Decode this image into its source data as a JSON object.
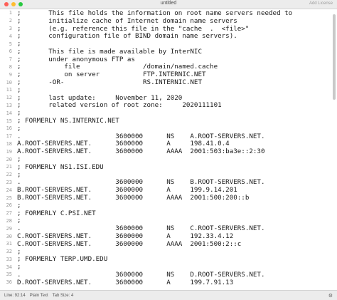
{
  "window": {
    "title": "untitled",
    "add_license": "Add License"
  },
  "editor": {
    "lines": [
      {
        "n": "1",
        "text": ";       This file holds the information on root name servers needed to"
      },
      {
        "n": "2",
        "text": ";       initialize cache of Internet domain name servers"
      },
      {
        "n": "3",
        "text": ";       (e.g. reference this file in the \"cache  .  <file>\""
      },
      {
        "n": "4",
        "text": ";       configuration file of BIND domain name servers)."
      },
      {
        "n": "5",
        "text": ";"
      },
      {
        "n": "6",
        "text": ";       This file is made available by InterNIC"
      },
      {
        "n": "7",
        "text": ";       under anonymous FTP as"
      },
      {
        "n": "8",
        "text": ";           file                /domain/named.cache"
      },
      {
        "n": "9",
        "text": ";           on server           FTP.INTERNIC.NET"
      },
      {
        "n": "10",
        "text": ";       -OR-                    RS.INTERNIC.NET"
      },
      {
        "n": "11",
        "text": ";"
      },
      {
        "n": "12",
        "text": ";       last update:     November 11, 2020"
      },
      {
        "n": "13",
        "text": ";       related version of root zone:     2020111101"
      },
      {
        "n": "14",
        "text": ";"
      },
      {
        "n": "15",
        "text": "; FORMERLY NS.INTERNIC.NET"
      },
      {
        "n": "16",
        "text": ";"
      },
      {
        "n": "17",
        "text": ".                        3600000      NS    A.ROOT-SERVERS.NET."
      },
      {
        "n": "18",
        "text": "A.ROOT-SERVERS.NET.      3600000      A     198.41.0.4"
      },
      {
        "n": "19",
        "text": "A.ROOT-SERVERS.NET.      3600000      AAAA  2001:503:ba3e::2:30"
      },
      {
        "n": "20",
        "text": ";"
      },
      {
        "n": "21",
        "text": "; FORMERLY NS1.ISI.EDU"
      },
      {
        "n": "22",
        "text": ";"
      },
      {
        "n": "23",
        "text": ".                        3600000      NS    B.ROOT-SERVERS.NET."
      },
      {
        "n": "24",
        "text": "B.ROOT-SERVERS.NET.      3600000      A     199.9.14.201"
      },
      {
        "n": "25",
        "text": "B.ROOT-SERVERS.NET.      3600000      AAAA  2001:500:200::b"
      },
      {
        "n": "26",
        "text": ";"
      },
      {
        "n": "27",
        "text": "; FORMERLY C.PSI.NET"
      },
      {
        "n": "28",
        "text": ";"
      },
      {
        "n": "29",
        "text": ".                        3600000      NS    C.ROOT-SERVERS.NET."
      },
      {
        "n": "30",
        "text": "C.ROOT-SERVERS.NET.      3600000      A     192.33.4.12"
      },
      {
        "n": "31",
        "text": "C.ROOT-SERVERS.NET.      3600000      AAAA  2001:500:2::c"
      },
      {
        "n": "32",
        "text": ";"
      },
      {
        "n": "33",
        "text": "; FORMERLY TERP.UMD.EDU"
      },
      {
        "n": "34",
        "text": ";"
      },
      {
        "n": "35",
        "text": ".                        3600000      NS    D.ROOT-SERVERS.NET."
      },
      {
        "n": "36",
        "text": "D.ROOT-SERVERS.NET.      3600000      A     199.7.91.13"
      }
    ]
  },
  "status": {
    "position": "Line: 92:14",
    "syntax": "Plain Text",
    "tab_size": "Tab Size: 4"
  }
}
